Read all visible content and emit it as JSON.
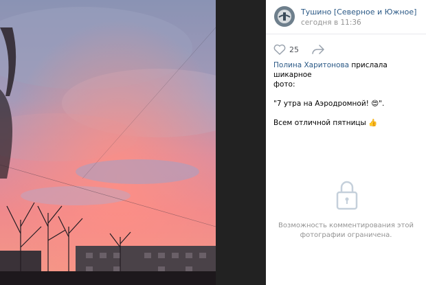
{
  "post": {
    "author": "Тушино [Северное и Южное]",
    "time": "сегодня в 11:36",
    "likes": "25"
  },
  "description": {
    "mention": "Полина Харитонова",
    "line1_rest": " прислала шикарное",
    "line2": "фото:",
    "quote": "\"7 утра на Аэродромной! 😍\".",
    "closing": "Всем отличной пятницы 👍"
  },
  "comments": {
    "restricted_line1": "Возможность комментирования этой",
    "restricted_line2": "фотографии ограничена."
  },
  "icons": {
    "like": "heart-icon",
    "share": "share-arrow-icon",
    "lock": "lock-icon"
  },
  "colors": {
    "link": "#2a5885",
    "muted": "#939393",
    "viewer_bg": "#222222"
  }
}
